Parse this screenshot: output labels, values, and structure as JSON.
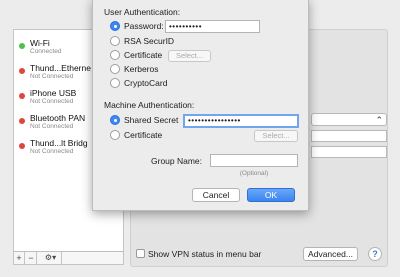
{
  "services": [
    {
      "name": "Wi-Fi",
      "status": "Connected",
      "dot_color": "#4bc24b"
    },
    {
      "name": "Thund...Etherne",
      "status": "Not Connected",
      "dot_color": "#e0443e"
    },
    {
      "name": "iPhone USB",
      "status": "Not Connected",
      "dot_color": "#e0443e"
    },
    {
      "name": "Bluetooth PAN",
      "status": "Not Connected",
      "dot_color": "#e0443e"
    },
    {
      "name": "Thund...lt Bridg",
      "status": "Not Connected",
      "dot_color": "#e0443e"
    }
  ],
  "left_toolbar": {
    "add": "+",
    "remove": "−",
    "gear": "⚙▾"
  },
  "bottom": {
    "show_vpn_label": "Show VPN status in menu bar",
    "advanced_label": "Advanced...",
    "help_label": "?"
  },
  "sheet": {
    "user_auth_title": "User Authentication:",
    "user_options": [
      {
        "label": "Password:",
        "selected": true
      },
      {
        "label": "RSA SecurID",
        "selected": false
      },
      {
        "label": "Certificate",
        "selected": false
      },
      {
        "label": "Kerberos",
        "selected": false
      },
      {
        "label": "CryptoCard",
        "selected": false
      }
    ],
    "password_value": "••••••••••",
    "user_select_label": "Select...",
    "machine_auth_title": "Machine Authentication:",
    "machine_options": [
      {
        "label": "Shared Secret",
        "selected": true
      },
      {
        "label": "Certificate",
        "selected": false
      }
    ],
    "shared_secret_value": "••••••••••••••••",
    "machine_select_label": "Select...",
    "group_name_label": "Group Name:",
    "group_name_value": "",
    "optional_hint": "(Optional)",
    "cancel_label": "Cancel",
    "ok_label": "OK"
  },
  "colors": {
    "accent": "#3b88f5",
    "connected": "#4bc24b",
    "disconnected": "#e0443e"
  }
}
